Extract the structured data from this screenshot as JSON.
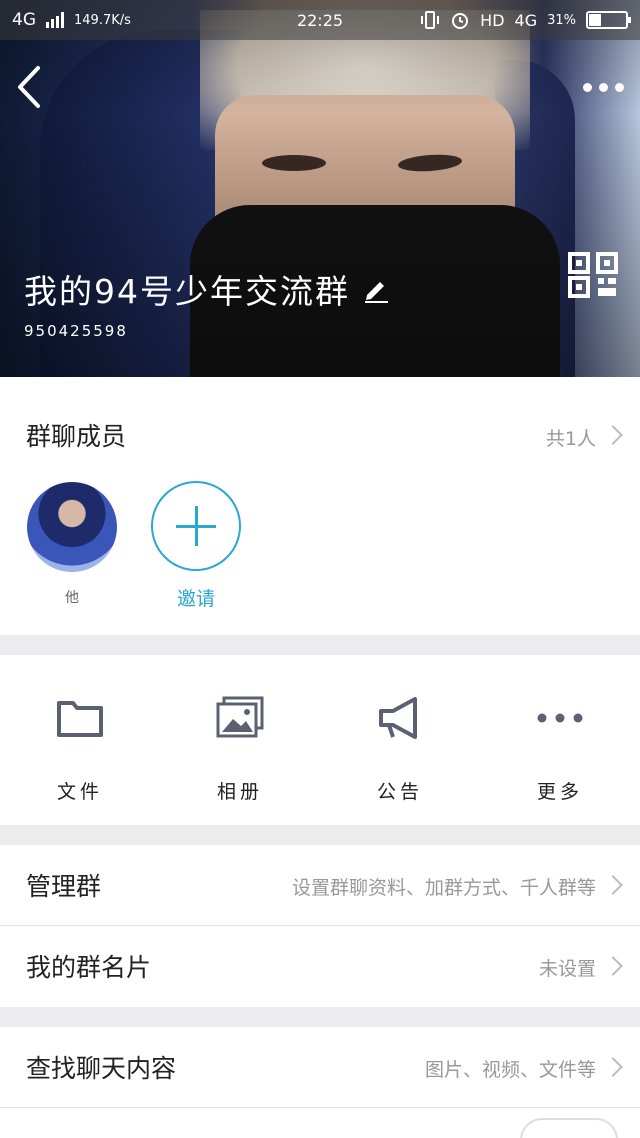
{
  "status_bar": {
    "network": "4G",
    "speed": "149.7K/s",
    "time": "22:25",
    "hd": "HD",
    "network2": "4G",
    "battery": "31%"
  },
  "header": {
    "group_name": "我的94号少年交流群",
    "group_id": "950425598"
  },
  "members": {
    "title": "群聊成员",
    "count": "共1人",
    "items": [
      {
        "name": "他"
      }
    ],
    "invite_label": "邀请"
  },
  "tools": [
    {
      "label": "文件",
      "icon": "folder-icon"
    },
    {
      "label": "相册",
      "icon": "photo-album-icon"
    },
    {
      "label": "公告",
      "icon": "megaphone-icon"
    },
    {
      "label": "更多",
      "icon": "more-dots-icon"
    }
  ],
  "settings": {
    "manage": {
      "label": "管理群",
      "value": "设置群聊资料、加群方式、千人群等"
    },
    "card": {
      "label": "我的群名片",
      "value": "未设置"
    },
    "search": {
      "label": "查找聊天内容",
      "value": "图片、视频、文件等"
    }
  },
  "colors": {
    "accent": "#2aa8cf",
    "background": "#ececee"
  }
}
